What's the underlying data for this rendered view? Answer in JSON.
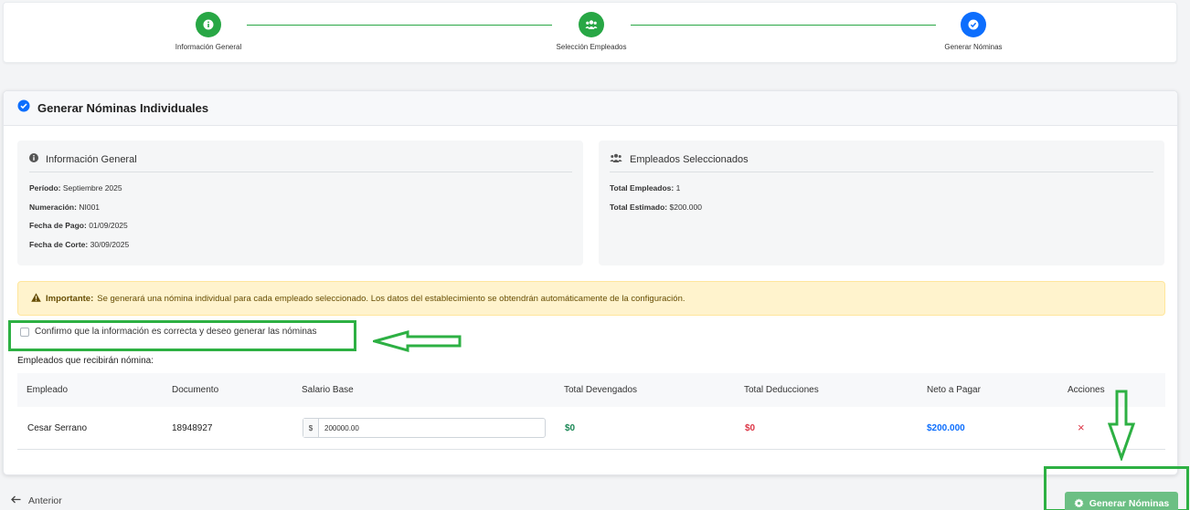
{
  "stepper": {
    "steps": [
      {
        "label": "Información General",
        "icon": "info-icon",
        "state": "done"
      },
      {
        "label": "Selección Empleados",
        "icon": "users-icon",
        "state": "done"
      },
      {
        "label": "Generar Nóminas",
        "icon": "check-icon",
        "state": "active"
      }
    ]
  },
  "card": {
    "title": "Generar Nóminas Individuales",
    "general_info": {
      "title": "Información General",
      "rows": [
        {
          "label": "Período:",
          "value": "Septiembre 2025"
        },
        {
          "label": "Numeración:",
          "value": "NI001"
        },
        {
          "label": "Fecha de Pago:",
          "value": "01/09/2025"
        },
        {
          "label": "Fecha de Corte:",
          "value": "30/09/2025"
        }
      ]
    },
    "selected_employees": {
      "title": "Empleados Seleccionados",
      "rows": [
        {
          "label": "Total Empleados:",
          "value": "1"
        },
        {
          "label": "Total Estimado:",
          "value": "$200.000"
        }
      ]
    },
    "warning": {
      "label": "Importante:",
      "text": "Se generará una nómina individual para cada empleado seleccionado. Los datos del establecimiento se obtendrán automáticamente de la configuración."
    },
    "confirm_text": "Confirmo que la información es correcta y deseo generar las nóminas",
    "confirm_checked": false,
    "employees_label": "Empleados que recibirán nómina:",
    "table": {
      "headers": [
        "Empleado",
        "Documento",
        "Salario Base",
        "Total Devengados",
        "Total Deducciones",
        "Neto a Pagar",
        "Acciones"
      ],
      "rows": [
        {
          "empleado": "Cesar Serrano",
          "documento": "18948927",
          "salario_prefix": "$",
          "salario_base": "200000.00",
          "devengados": "$0",
          "deducciones": "$0",
          "neto": "$200.000",
          "accion_icon": "×"
        }
      ]
    }
  },
  "footer": {
    "back_label": "Anterior",
    "submit_label": "Generar Nóminas"
  },
  "colors": {
    "primary": "#0d6efd",
    "success": "#28a745",
    "danger": "#dc3545",
    "warning_bg": "#fff3cd",
    "annotation": "#2db043"
  }
}
